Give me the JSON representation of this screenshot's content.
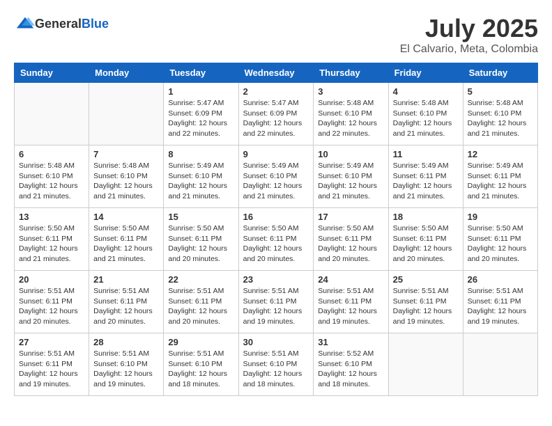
{
  "header": {
    "logo_general": "General",
    "logo_blue": "Blue",
    "month_year": "July 2025",
    "location": "El Calvario, Meta, Colombia"
  },
  "weekdays": [
    "Sunday",
    "Monday",
    "Tuesday",
    "Wednesday",
    "Thursday",
    "Friday",
    "Saturday"
  ],
  "weeks": [
    [
      {
        "day": "",
        "info": ""
      },
      {
        "day": "",
        "info": ""
      },
      {
        "day": "1",
        "info": "Sunrise: 5:47 AM\nSunset: 6:09 PM\nDaylight: 12 hours and 22 minutes."
      },
      {
        "day": "2",
        "info": "Sunrise: 5:47 AM\nSunset: 6:09 PM\nDaylight: 12 hours and 22 minutes."
      },
      {
        "day": "3",
        "info": "Sunrise: 5:48 AM\nSunset: 6:10 PM\nDaylight: 12 hours and 22 minutes."
      },
      {
        "day": "4",
        "info": "Sunrise: 5:48 AM\nSunset: 6:10 PM\nDaylight: 12 hours and 21 minutes."
      },
      {
        "day": "5",
        "info": "Sunrise: 5:48 AM\nSunset: 6:10 PM\nDaylight: 12 hours and 21 minutes."
      }
    ],
    [
      {
        "day": "6",
        "info": "Sunrise: 5:48 AM\nSunset: 6:10 PM\nDaylight: 12 hours and 21 minutes."
      },
      {
        "day": "7",
        "info": "Sunrise: 5:48 AM\nSunset: 6:10 PM\nDaylight: 12 hours and 21 minutes."
      },
      {
        "day": "8",
        "info": "Sunrise: 5:49 AM\nSunset: 6:10 PM\nDaylight: 12 hours and 21 minutes."
      },
      {
        "day": "9",
        "info": "Sunrise: 5:49 AM\nSunset: 6:10 PM\nDaylight: 12 hours and 21 minutes."
      },
      {
        "day": "10",
        "info": "Sunrise: 5:49 AM\nSunset: 6:10 PM\nDaylight: 12 hours and 21 minutes."
      },
      {
        "day": "11",
        "info": "Sunrise: 5:49 AM\nSunset: 6:11 PM\nDaylight: 12 hours and 21 minutes."
      },
      {
        "day": "12",
        "info": "Sunrise: 5:49 AM\nSunset: 6:11 PM\nDaylight: 12 hours and 21 minutes."
      }
    ],
    [
      {
        "day": "13",
        "info": "Sunrise: 5:50 AM\nSunset: 6:11 PM\nDaylight: 12 hours and 21 minutes."
      },
      {
        "day": "14",
        "info": "Sunrise: 5:50 AM\nSunset: 6:11 PM\nDaylight: 12 hours and 21 minutes."
      },
      {
        "day": "15",
        "info": "Sunrise: 5:50 AM\nSunset: 6:11 PM\nDaylight: 12 hours and 20 minutes."
      },
      {
        "day": "16",
        "info": "Sunrise: 5:50 AM\nSunset: 6:11 PM\nDaylight: 12 hours and 20 minutes."
      },
      {
        "day": "17",
        "info": "Sunrise: 5:50 AM\nSunset: 6:11 PM\nDaylight: 12 hours and 20 minutes."
      },
      {
        "day": "18",
        "info": "Sunrise: 5:50 AM\nSunset: 6:11 PM\nDaylight: 12 hours and 20 minutes."
      },
      {
        "day": "19",
        "info": "Sunrise: 5:50 AM\nSunset: 6:11 PM\nDaylight: 12 hours and 20 minutes."
      }
    ],
    [
      {
        "day": "20",
        "info": "Sunrise: 5:51 AM\nSunset: 6:11 PM\nDaylight: 12 hours and 20 minutes."
      },
      {
        "day": "21",
        "info": "Sunrise: 5:51 AM\nSunset: 6:11 PM\nDaylight: 12 hours and 20 minutes."
      },
      {
        "day": "22",
        "info": "Sunrise: 5:51 AM\nSunset: 6:11 PM\nDaylight: 12 hours and 20 minutes."
      },
      {
        "day": "23",
        "info": "Sunrise: 5:51 AM\nSunset: 6:11 PM\nDaylight: 12 hours and 19 minutes."
      },
      {
        "day": "24",
        "info": "Sunrise: 5:51 AM\nSunset: 6:11 PM\nDaylight: 12 hours and 19 minutes."
      },
      {
        "day": "25",
        "info": "Sunrise: 5:51 AM\nSunset: 6:11 PM\nDaylight: 12 hours and 19 minutes."
      },
      {
        "day": "26",
        "info": "Sunrise: 5:51 AM\nSunset: 6:11 PM\nDaylight: 12 hours and 19 minutes."
      }
    ],
    [
      {
        "day": "27",
        "info": "Sunrise: 5:51 AM\nSunset: 6:11 PM\nDaylight: 12 hours and 19 minutes."
      },
      {
        "day": "28",
        "info": "Sunrise: 5:51 AM\nSunset: 6:10 PM\nDaylight: 12 hours and 19 minutes."
      },
      {
        "day": "29",
        "info": "Sunrise: 5:51 AM\nSunset: 6:10 PM\nDaylight: 12 hours and 18 minutes."
      },
      {
        "day": "30",
        "info": "Sunrise: 5:51 AM\nSunset: 6:10 PM\nDaylight: 12 hours and 18 minutes."
      },
      {
        "day": "31",
        "info": "Sunrise: 5:52 AM\nSunset: 6:10 PM\nDaylight: 12 hours and 18 minutes."
      },
      {
        "day": "",
        "info": ""
      },
      {
        "day": "",
        "info": ""
      }
    ]
  ]
}
